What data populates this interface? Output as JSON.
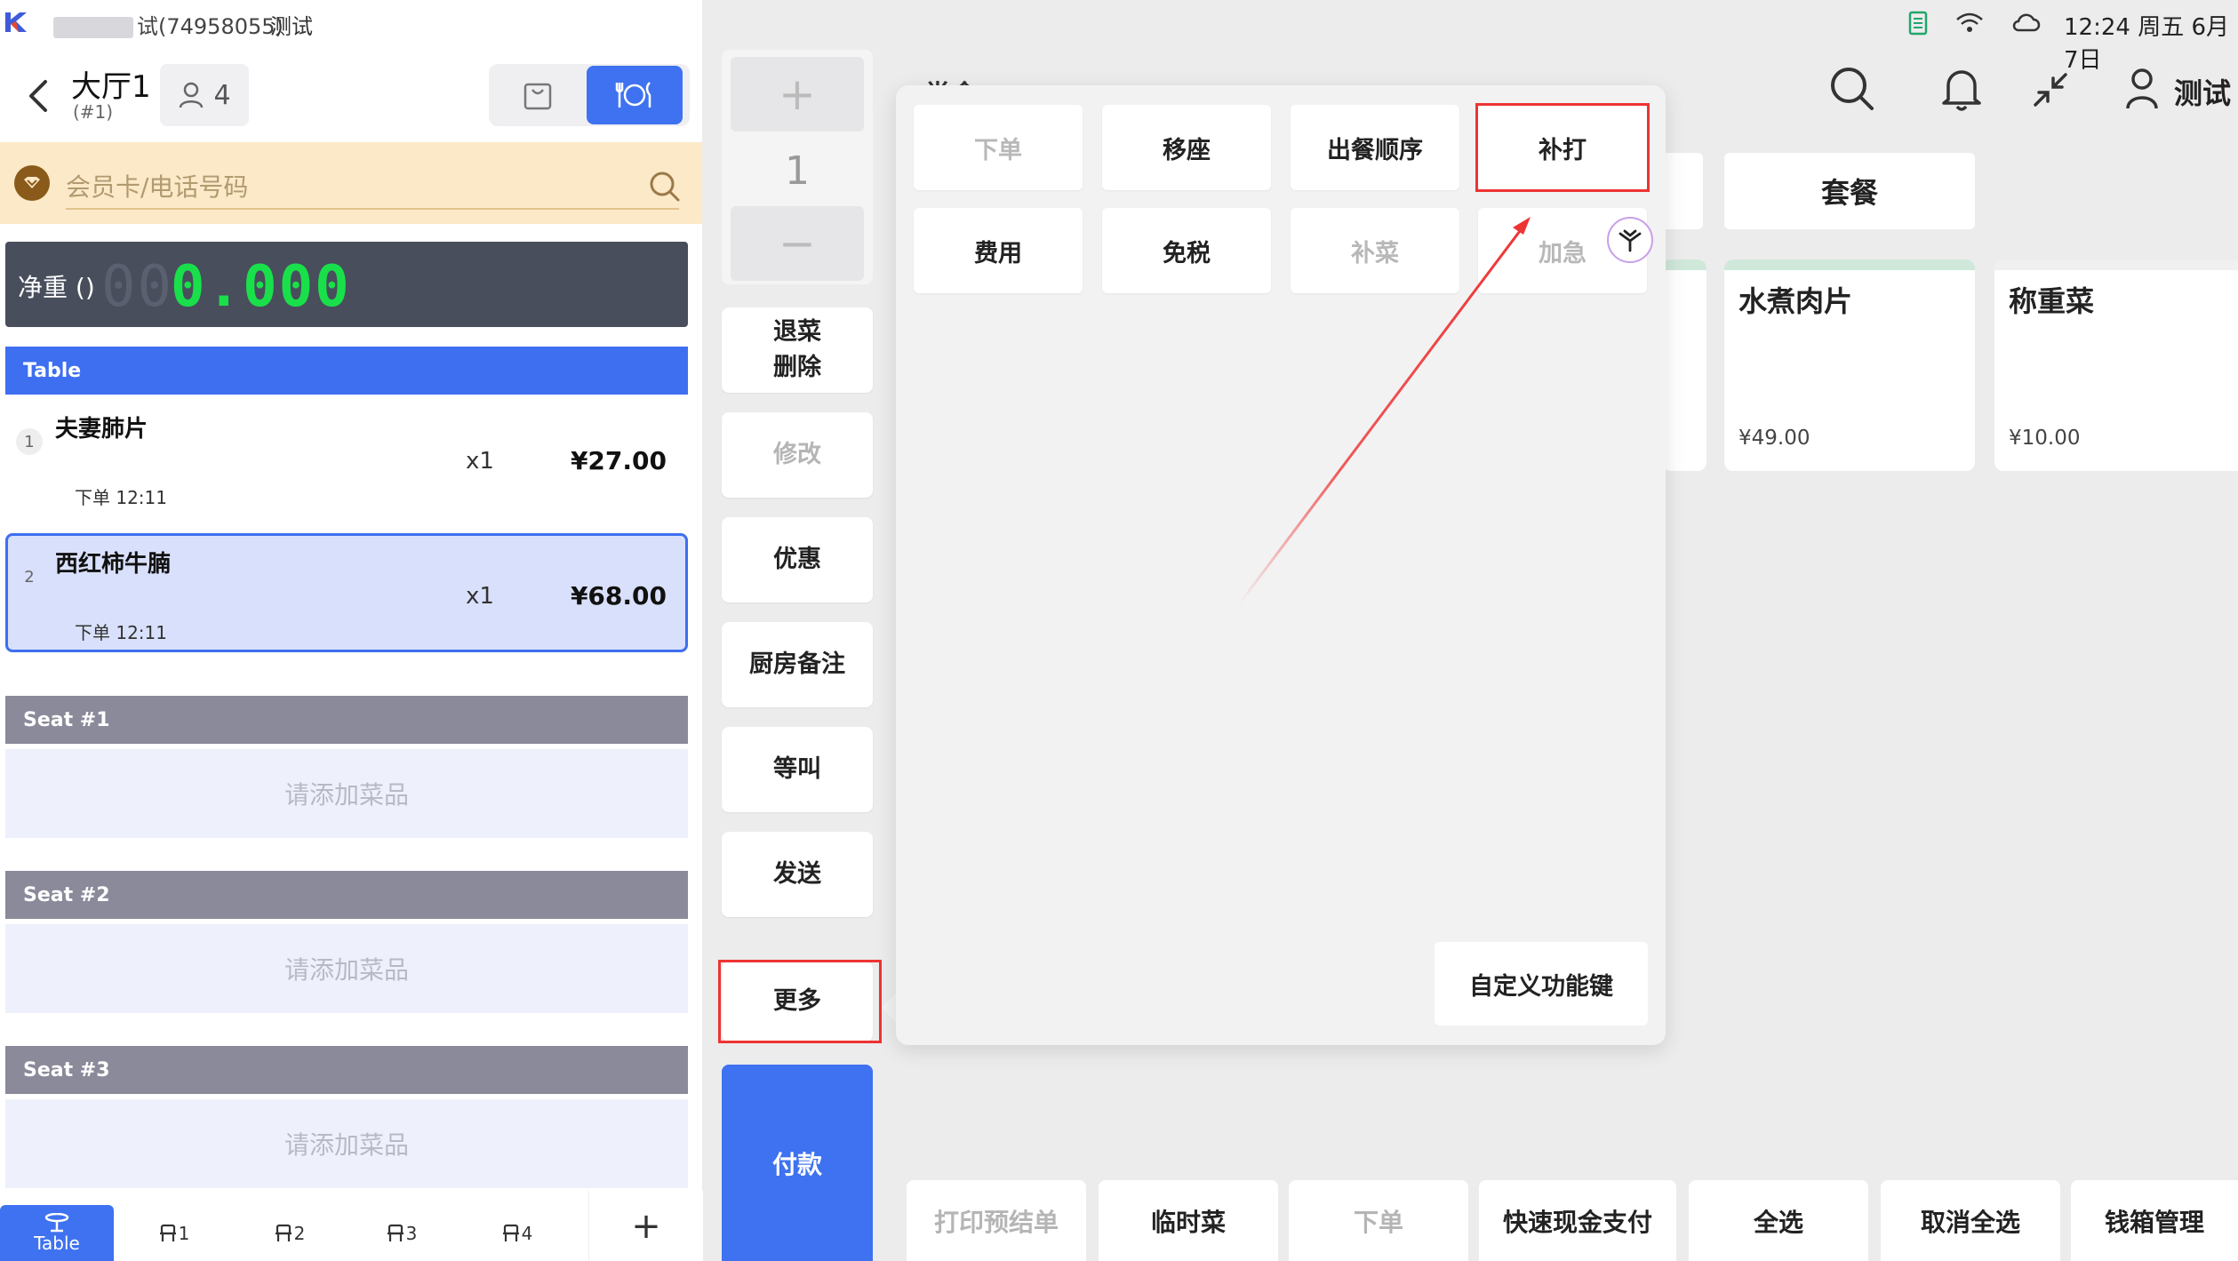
{
  "status": {
    "store_id": "试(74958055)",
    "mode": "测试",
    "clock": "12:24 周五 6月 7日"
  },
  "order": {
    "table_name": "大厅1",
    "table_no": "(#1)",
    "guests": "4",
    "member_placeholder": "会员卡/电话号码",
    "scale_label": "净重 ()",
    "scale_ghost": "00",
    "scale_value": "0.000",
    "section_table": "Table",
    "items": [
      {
        "idx": "1",
        "name": "夫妻肺片",
        "qty": "x1",
        "price": "¥27.00",
        "status": "下单 12:11"
      },
      {
        "idx": "2",
        "name": "西红柿牛腩",
        "qty": "x1",
        "price": "¥68.00",
        "status": "下单 12:11"
      }
    ],
    "seats": [
      {
        "label": "Seat #1",
        "empty": "请添加菜品"
      },
      {
        "label": "Seat #2",
        "empty": "请添加菜品"
      },
      {
        "label": "Seat #3",
        "empty": "请添加菜品"
      }
    ],
    "tabs": [
      {
        "label": "Table"
      },
      {
        "label": "1"
      },
      {
        "label": "2"
      },
      {
        "label": "3"
      },
      {
        "label": "4"
      },
      {
        "label": "+"
      }
    ]
  },
  "actions": {
    "qty_plus": "+",
    "qty_value": "1",
    "qty_minus": "−",
    "return_line1": "退菜",
    "return_line2": "删除",
    "modify": "修改",
    "discount": "优惠",
    "kitchen_note": "厨房备注",
    "hold": "等叫",
    "send": "发送",
    "more": "更多",
    "pay": "付款"
  },
  "menu": {
    "title": "堂食",
    "user": "测试",
    "categories": [
      "套餐"
    ],
    "dishes": [
      {
        "name": "水煮肉片",
        "price": "¥49.00"
      },
      {
        "name": "称重菜",
        "price": "¥10.00"
      }
    ],
    "bottom_buttons": [
      {
        "label": "打印预结单",
        "dim": true
      },
      {
        "label": "临时菜",
        "dim": false
      },
      {
        "label": "下单",
        "dim": true
      },
      {
        "label": "快速现金支付",
        "dim": false
      },
      {
        "label": "全选",
        "dim": false
      },
      {
        "label": "取消全选",
        "dim": false
      },
      {
        "label": "钱箱管理",
        "dim": false
      }
    ]
  },
  "popup": {
    "row1": [
      {
        "label": "下单",
        "dim": true
      },
      {
        "label": "移座",
        "dim": false
      },
      {
        "label": "出餐顺序",
        "dim": false
      },
      {
        "label": "补打",
        "dim": false
      }
    ],
    "row2": [
      {
        "label": "费用",
        "dim": false
      },
      {
        "label": "免税",
        "dim": false
      },
      {
        "label": "补菜",
        "dim": true
      },
      {
        "label": "加急",
        "dim": true
      }
    ],
    "custom_keys": "自定义功能键"
  },
  "colors": {
    "accent": "#3e72f0",
    "highlight_outline": "#e33333",
    "scale_digits": "#19e04a"
  }
}
